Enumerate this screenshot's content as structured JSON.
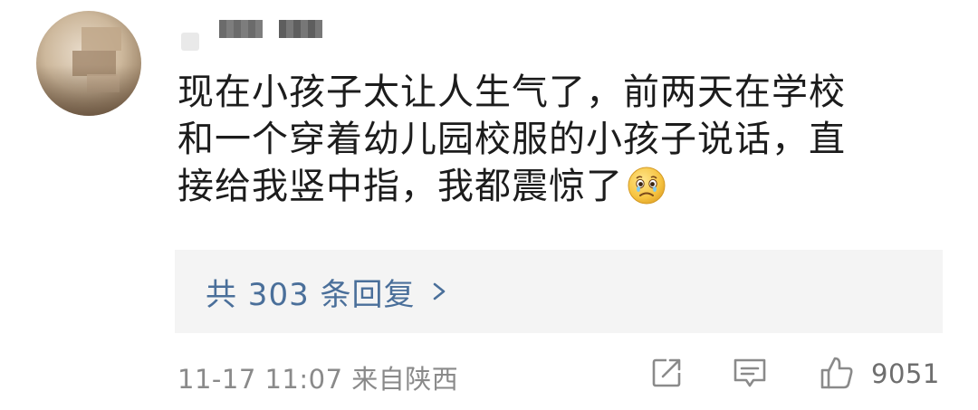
{
  "comment": {
    "line1": "现在小孩子太让人生气了，前两天在学校",
    "line2": "和一个穿着幼儿园校服的小孩子说话，直",
    "line3": "接给我竖中指，我都震惊了",
    "emoji": "sad-crying-face-emoji"
  },
  "replies": {
    "label": "共 303 条回复",
    "chevron": "chevron-right-icon",
    "color": "#4a6f9a"
  },
  "footer": {
    "timestamp": "11-17 11:07",
    "location": "来自陕西",
    "share_icon": "share-icon",
    "comment_icon": "comment-icon",
    "like_icon": "thumbs-up-icon",
    "like_count": "9051"
  },
  "colors": {
    "text": "#1c1c1c",
    "meta": "#8a8a8a",
    "reply_bg": "#f4f4f4"
  }
}
